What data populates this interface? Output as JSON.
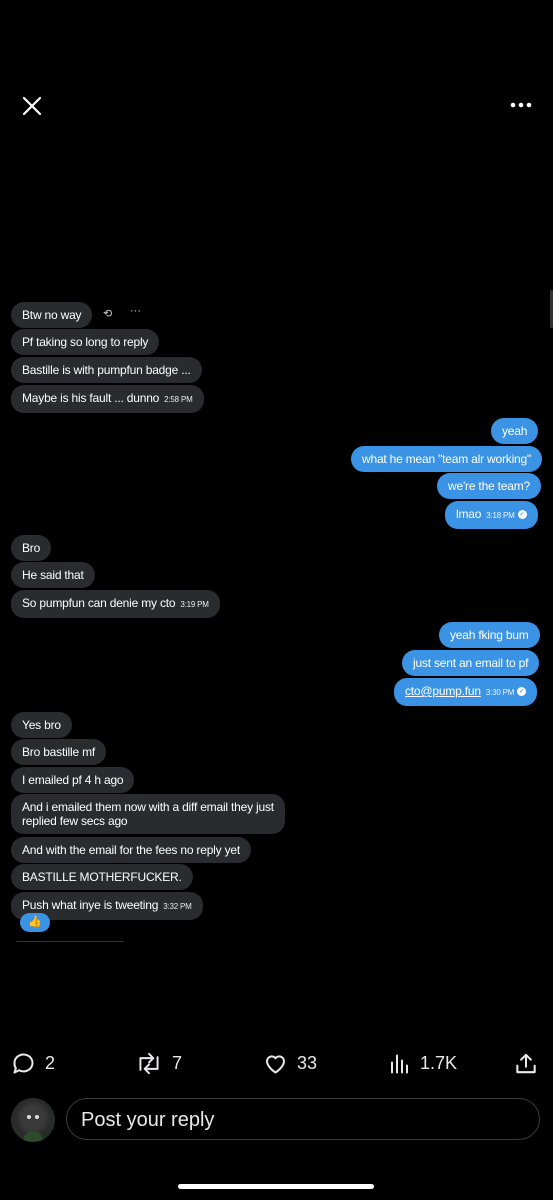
{
  "header": {
    "close_icon": "close-icon",
    "more_icon": "more-horizontal-icon"
  },
  "messages": {
    "m1": "Btw no way",
    "m2": "Pf taking so long to reply",
    "m3": "Bastille is with pumpfun badge ...",
    "m4": "Maybe is his fault ... dunno",
    "m4_time": "2:58 PM",
    "o1": "yeah",
    "o2": "what he mean \"team alr working\"",
    "o3": "we're the team?",
    "o4": "lmao",
    "o4_time": "3:18 PM",
    "m5": "Bro",
    "m6": "He said that",
    "m7": "So pumpfun can denie my cto",
    "m7_time": "3:19 PM",
    "o5": "yeah fking bum",
    "o6": "just sent an email to pf",
    "o7": "cto@pump.fun",
    "o7_time": "3:30 PM",
    "m8": "Yes bro",
    "m9": "Bro bastille mf",
    "m10": "I emailed pf 4 h ago",
    "m11_line1": "And i emailed them now with a diff email they just",
    "m11_line2": "replied few secs ago",
    "m12": "And with the email for the fees no reply yet",
    "m13": "BASTILLE MOTHERFUCKER.",
    "m14": "Push what inye is tweeting",
    "m14_time": "3:32 PM",
    "reaction": "👍"
  },
  "actions": {
    "replies": "2",
    "reposts": "7",
    "likes": "33",
    "views": "1.7K"
  },
  "reply_bar": {
    "placeholder": "Post your reply"
  }
}
